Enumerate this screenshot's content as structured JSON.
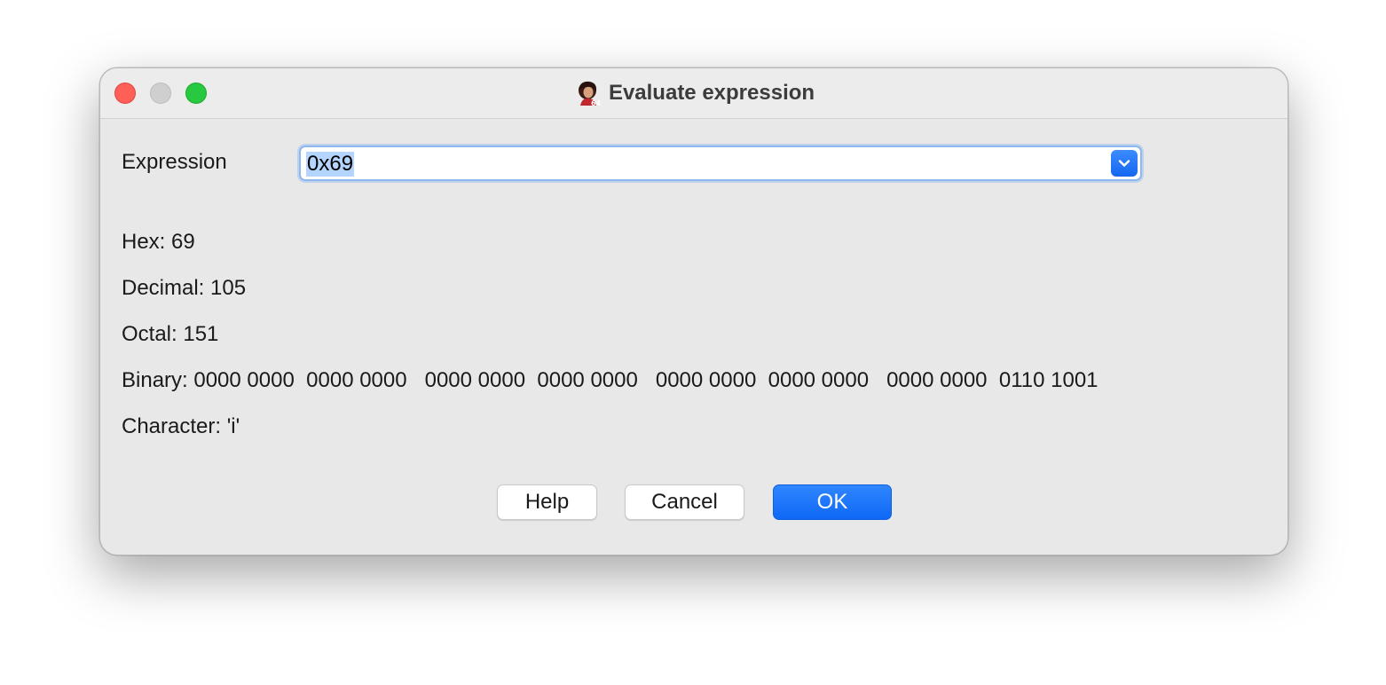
{
  "window": {
    "title": "Evaluate expression",
    "app_icon": "app-portrait-icon"
  },
  "expression": {
    "label": "Expression",
    "value": "0x69",
    "dropdown_icon": "chevron-down-icon"
  },
  "results": {
    "hex": "Hex: 69",
    "decimal": "Decimal: 105",
    "octal": "Octal: 151",
    "binary": "Binary: 0000 0000  0000 0000   0000 0000  0000 0000   0000 0000  0000 0000   0000 0000  0110 1001",
    "character": "Character: 'i'"
  },
  "buttons": {
    "help": "Help",
    "cancel": "Cancel",
    "ok": "OK"
  },
  "colors": {
    "accent": "#1466f0",
    "close": "#fe5f57",
    "zoom": "#28c840",
    "selection": "#b3d5ff"
  }
}
